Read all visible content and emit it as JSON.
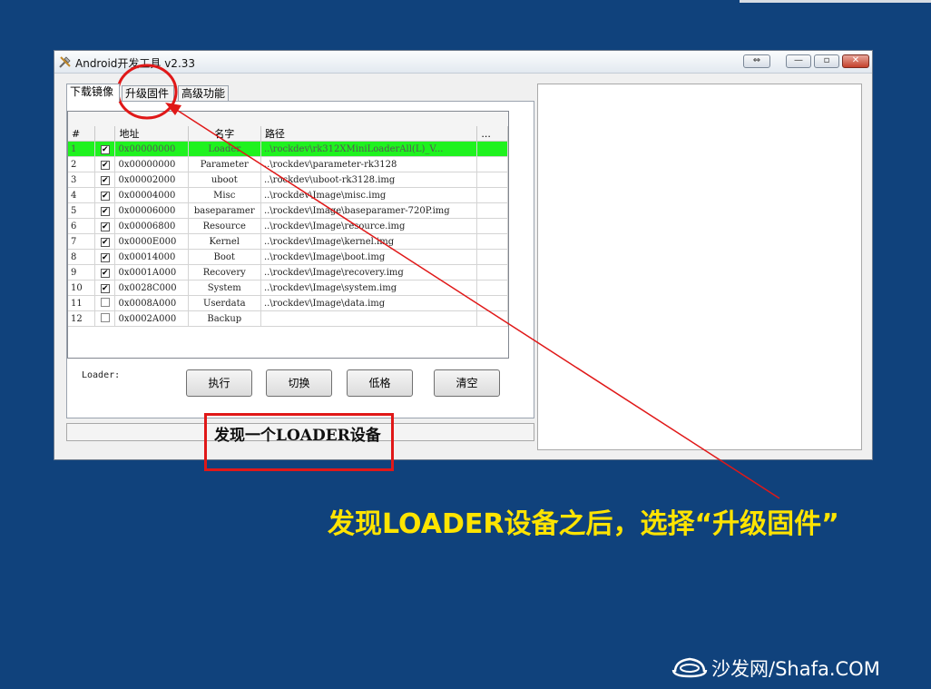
{
  "window": {
    "title": "Android开发工具 v2.33",
    "controls": {
      "switch": "⇔",
      "minimize": "—",
      "maximize": "▫",
      "close": "✕"
    }
  },
  "tabs": [
    {
      "label": "下载镜像",
      "active": true
    },
    {
      "label": "升级固件",
      "active": false
    },
    {
      "label": "高级功能",
      "active": false
    }
  ],
  "table": {
    "columns": [
      "#",
      "",
      "地址",
      "名字",
      "路径",
      "..."
    ],
    "rows": [
      {
        "num": "1",
        "checked": true,
        "addr": "0x00000000",
        "name": "Loader",
        "path": "..\\rockdev\\rk312XMiniLoaderAll(L)_V...",
        "highlight": true
      },
      {
        "num": "2",
        "checked": true,
        "addr": "0x00000000",
        "name": "Parameter",
        "path": "..\\rockdev\\parameter-rk3128",
        "highlight": false
      },
      {
        "num": "3",
        "checked": true,
        "addr": "0x00002000",
        "name": "uboot",
        "path": "..\\rockdev\\uboot-rk3128.img",
        "highlight": false
      },
      {
        "num": "4",
        "checked": true,
        "addr": "0x00004000",
        "name": "Misc",
        "path": "..\\rockdev\\Image\\misc.img",
        "highlight": false
      },
      {
        "num": "5",
        "checked": true,
        "addr": "0x00006000",
        "name": "baseparamer",
        "path": "..\\rockdev\\Image\\baseparamer-720P.img",
        "highlight": false
      },
      {
        "num": "6",
        "checked": true,
        "addr": "0x00006800",
        "name": "Resource",
        "path": "..\\rockdev\\Image\\resource.img",
        "highlight": false
      },
      {
        "num": "7",
        "checked": true,
        "addr": "0x0000E000",
        "name": "Kernel",
        "path": "..\\rockdev\\Image\\kernel.img",
        "highlight": false
      },
      {
        "num": "8",
        "checked": true,
        "addr": "0x00014000",
        "name": "Boot",
        "path": "..\\rockdev\\Image\\boot.img",
        "highlight": false
      },
      {
        "num": "9",
        "checked": true,
        "addr": "0x0001A000",
        "name": "Recovery",
        "path": "..\\rockdev\\Image\\recovery.img",
        "highlight": false
      },
      {
        "num": "10",
        "checked": true,
        "addr": "0x0028C000",
        "name": "System",
        "path": "..\\rockdev\\Image\\system.img",
        "highlight": false
      },
      {
        "num": "11",
        "checked": false,
        "addr": "0x0008A000",
        "name": "Userdata",
        "path": "..\\rockdev\\Image\\data.img",
        "highlight": false
      },
      {
        "num": "12",
        "checked": false,
        "addr": "0x0002A000",
        "name": "Backup",
        "path": "",
        "highlight": false
      }
    ]
  },
  "loader_label": "Loader:",
  "buttons": {
    "execute": "执行",
    "switch": "切换",
    "low_format": "低格",
    "clear": "清空"
  },
  "status_message": "发现一个LOADER设备",
  "annotation": "发现LOADER设备之后，选择“升级固件”",
  "watermark": "沙发网/Shafa.COM",
  "colors": {
    "background": "#10427c",
    "highlight_row": "#1ff21f",
    "annotation_text": "#ffe400",
    "annotation_red": "#e01818"
  }
}
